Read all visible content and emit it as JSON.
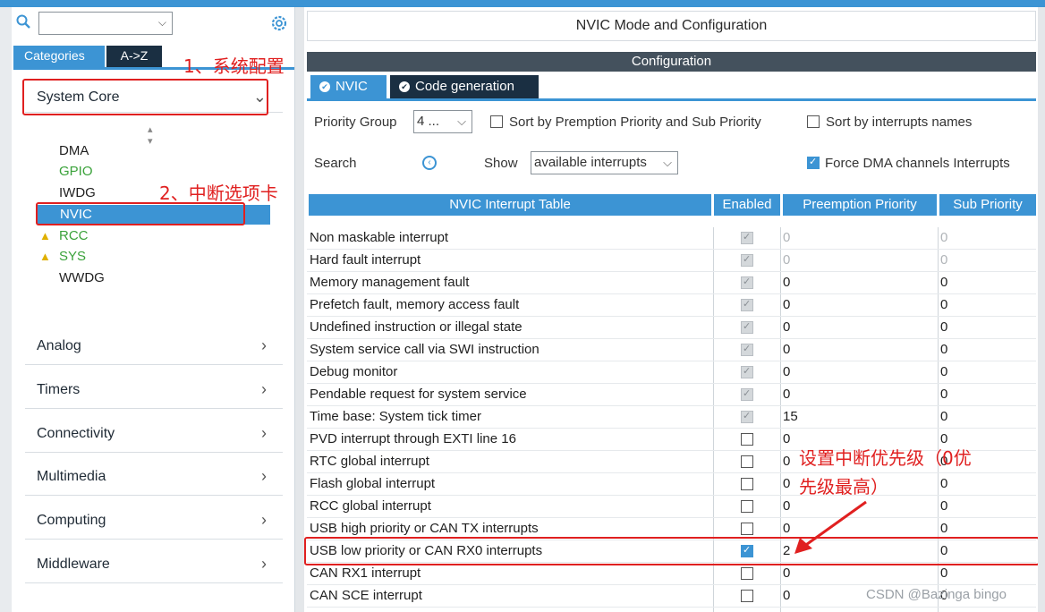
{
  "left": {
    "tabs": {
      "categories": "Categories",
      "az": "A->Z"
    },
    "categories": [
      {
        "label": "System Core",
        "arrow": "⌄"
      },
      {
        "label": "Analog",
        "arrow": "›"
      },
      {
        "label": "Timers",
        "arrow": "›"
      },
      {
        "label": "Connectivity",
        "arrow": "›"
      },
      {
        "label": "Multimedia",
        "arrow": "›"
      },
      {
        "label": "Computing",
        "arrow": "›"
      },
      {
        "label": "Middleware",
        "arrow": "›"
      }
    ],
    "peripherals": [
      {
        "label": "DMA",
        "color": "#333333"
      },
      {
        "label": "GPIO",
        "color": "#3aa23a"
      },
      {
        "label": "IWDG",
        "color": "#333333"
      },
      {
        "label": "NVIC",
        "color": "#ffffff"
      },
      {
        "label": "RCC",
        "color": "#3aa23a"
      },
      {
        "label": "SYS",
        "color": "#3aa23a"
      },
      {
        "label": "WWDG",
        "color": "#333333"
      }
    ]
  },
  "annotations": {
    "step1": "1、系统配置",
    "step2": "2、中断选项卡",
    "priority_note_line1": "设置中断优先级（0优",
    "priority_note_line2": "先级最高）"
  },
  "main": {
    "header": "NVIC Mode and Configuration",
    "configuration": "Configuration",
    "tabs": {
      "nvic": "NVIC",
      "code": "Code generation"
    },
    "priority_group_label": "Priority Group",
    "priority_group_value": "4 ...",
    "sort_preemption": "Sort by Premption Priority and Sub Priority",
    "sort_names": "Sort by interrupts names",
    "search_label": "Search",
    "show_label": "Show",
    "show_value": "available interrupts",
    "force_dma": "Force DMA channels Interrupts",
    "columns": {
      "table": "NVIC Interrupt Table",
      "enabled": "Enabled",
      "preemption": "Preemption Priority",
      "sub": "Sub Priority"
    },
    "rows": [
      {
        "name": "Non maskable interrupt",
        "enabled": "disabled-checked",
        "pp": "0",
        "sp": "0",
        "dim": true
      },
      {
        "name": "Hard fault interrupt",
        "enabled": "disabled-checked",
        "pp": "0",
        "sp": "0",
        "dim": true
      },
      {
        "name": "Memory management fault",
        "enabled": "disabled-checked",
        "pp": "0",
        "sp": "0",
        "dim": false
      },
      {
        "name": "Prefetch fault, memory access fault",
        "enabled": "disabled-checked",
        "pp": "0",
        "sp": "0",
        "dim": false
      },
      {
        "name": "Undefined instruction or illegal state",
        "enabled": "disabled-checked",
        "pp": "0",
        "sp": "0",
        "dim": false
      },
      {
        "name": "System service call via SWI instruction",
        "enabled": "disabled-checked",
        "pp": "0",
        "sp": "0",
        "dim": false
      },
      {
        "name": "Debug monitor",
        "enabled": "disabled-checked",
        "pp": "0",
        "sp": "0",
        "dim": false
      },
      {
        "name": "Pendable request for system service",
        "enabled": "disabled-checked",
        "pp": "0",
        "sp": "0",
        "dim": false
      },
      {
        "name": "Time base: System tick timer",
        "enabled": "disabled-checked",
        "pp": "15",
        "sp": "0",
        "dim": false
      },
      {
        "name": "PVD interrupt through EXTI line 16",
        "enabled": "off",
        "pp": "0",
        "sp": "0",
        "dim": false
      },
      {
        "name": "RTC global interrupt",
        "enabled": "off",
        "pp": "0",
        "sp": "0",
        "dim": false
      },
      {
        "name": "Flash global interrupt",
        "enabled": "off",
        "pp": "0",
        "sp": "0",
        "dim": false
      },
      {
        "name": "RCC global interrupt",
        "enabled": "off",
        "pp": "0",
        "sp": "0",
        "dim": false
      },
      {
        "name": "USB high priority or CAN TX interrupts",
        "enabled": "off",
        "pp": "0",
        "sp": "0",
        "dim": false
      },
      {
        "name": "USB low priority or CAN RX0 interrupts",
        "enabled": "on",
        "pp": "2",
        "sp": "0",
        "dim": false
      },
      {
        "name": "CAN RX1 interrupt",
        "enabled": "off",
        "pp": "0",
        "sp": "0",
        "dim": false
      },
      {
        "name": "CAN SCE interrupt",
        "enabled": "off",
        "pp": "0",
        "sp": "0",
        "dim": false
      }
    ]
  },
  "watermark": "CSDN @Bazinga bingo"
}
